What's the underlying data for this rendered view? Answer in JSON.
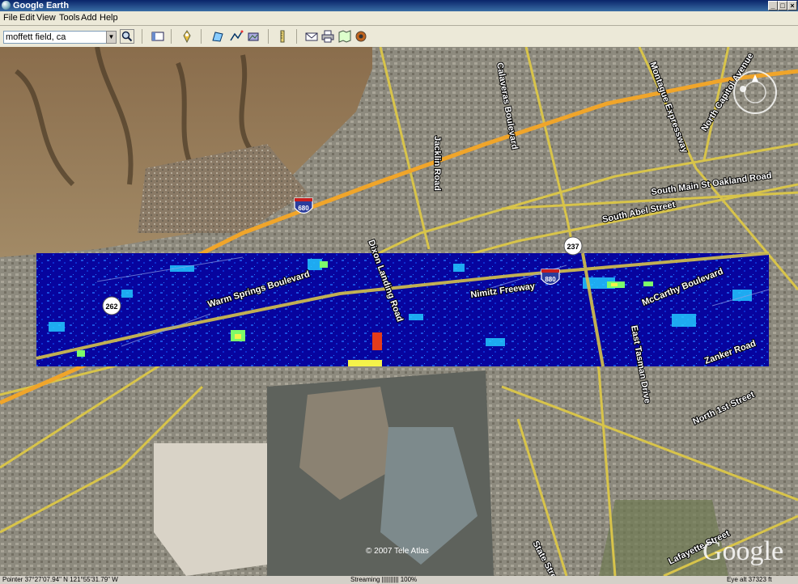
{
  "window": {
    "title": "Google Earth"
  },
  "menu": [
    "File",
    "Edit",
    "View",
    "Tools",
    "Add",
    "Help"
  ],
  "search": {
    "value": "moffett field, ca"
  },
  "map": {
    "roads": {
      "hwy_680": "680",
      "hwy_262": "262",
      "hwy_237": "237",
      "hwy_880": "880",
      "warm_springs": "Warm Springs Boulevard",
      "dixon": "Dixon Landing Road",
      "nimitz": "Nimitz Freeway",
      "mccarthy": "McCarthy Boulevard",
      "zanker": "Zanker Road",
      "calaveras": "Calaveras Boulevard",
      "jacklin": "Jacklin Road",
      "montague": "Montague Expressway",
      "north_capitol": "North Capitol Avenue",
      "abel": "South Abel Street",
      "oakland": "South Main St Oakland Road",
      "east_tasman": "East Tasman Drive",
      "north_first": "North 1st Street",
      "lafayette": "Lafayette Street",
      "state": "State Street"
    },
    "copyright": "© 2007 Tele Atlas",
    "logo": "Google"
  },
  "status": {
    "pointer": "Pointer  37°27'07.94\" N    121°55'31.79\" W",
    "streaming": "Streaming |||||||||| 100%",
    "eye_alt": "Eye alt   37323 ft"
  }
}
